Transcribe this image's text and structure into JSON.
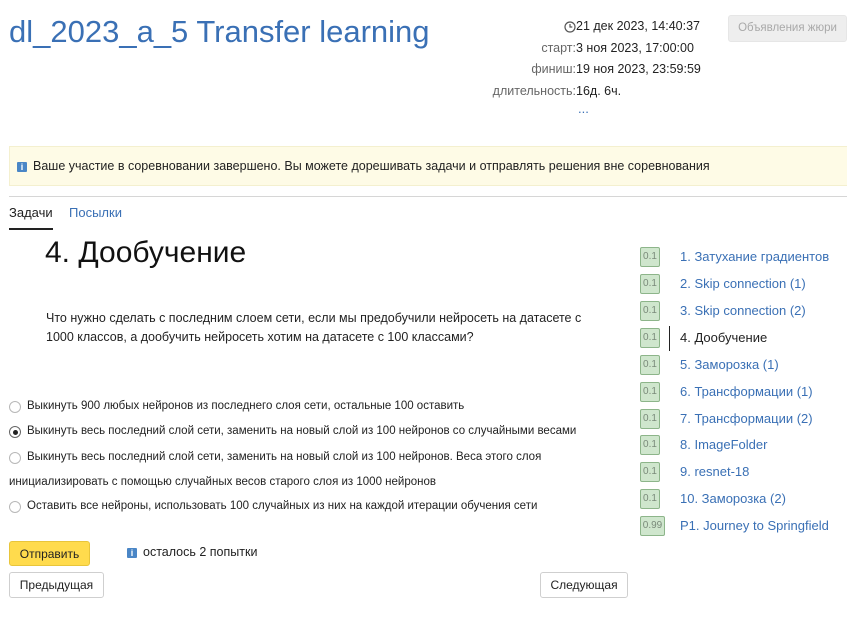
{
  "contest": {
    "title": "dl_2023_a_5 Transfer learning",
    "current_time": "21 дек 2023, 14:40:37",
    "start_label": "старт:",
    "start_value": "3 ноя 2023, 17:00:00",
    "finish_label": "финиш:",
    "finish_value": "19 ноя 2023, 23:59:59",
    "duration_label": "длительность:",
    "duration_value": "16д. 6ч.",
    "more_link": "...",
    "jury_button": "Объявления жюри"
  },
  "notice": {
    "icon": "info-icon",
    "text": "Ваше участие в соревновании завершено. Вы можете дорешивать задачи и отправлять решения вне соревнования"
  },
  "tabs": [
    {
      "label": "Задачи",
      "active": true
    },
    {
      "label": "Посылки",
      "active": false
    }
  ],
  "problem": {
    "title": "4. Дообучение",
    "statement": "Что нужно сделать с последним слоем сети, если мы предобучили нейросеть на датасете с 1000 классов, а дообучить нейросеть хотим на датасете с 100 классами?",
    "options": [
      {
        "text": "Выкинуть 900 любых нейронов из последнего слоя сети, остальные 100 оставить",
        "checked": false
      },
      {
        "text": "Выкинуть весь последний слой сети, заменить на новый слой из 100 нейронов со случайными весами",
        "checked": true
      },
      {
        "text": "Выкинуть весь последний слой сети, заменить на новый слой из 100 нейронов. Веса этого слоя",
        "continuation": "инициализировать с помощью случайных весов старого слоя из 1000 нейронов",
        "checked": false
      },
      {
        "text": "Оставить все нейроны, использовать 100 случайных из них на каждой итерации обучения сети",
        "checked": false
      }
    ],
    "submit_label": "Отправить",
    "attempts_text": "осталось 2 попытки",
    "prev_label": "Предыдущая",
    "next_label": "Следующая"
  },
  "problem_list": [
    {
      "score": "0.1",
      "name": "1. Затухание градиентов",
      "current": false
    },
    {
      "score": "0.1",
      "name": "2. Skip connection (1)",
      "current": false
    },
    {
      "score": "0.1",
      "name": "3. Skip connection (2)",
      "current": false
    },
    {
      "score": "0.1",
      "name": "4. Дообучение",
      "current": true
    },
    {
      "score": "0.1",
      "name": "5. Заморозка (1)",
      "current": false
    },
    {
      "score": "0.1",
      "name": "6. Трансформации (1)",
      "current": false
    },
    {
      "score": "0.1",
      "name": "7. Трансформации (2)",
      "current": false
    },
    {
      "score": "0.1",
      "name": "8. ImageFolder",
      "current": false
    },
    {
      "score": "0.1",
      "name": "9. resnet-18",
      "current": false
    },
    {
      "score": "0.1",
      "name": "10. Заморозка (2)",
      "current": false
    },
    {
      "score": "0.99",
      "name": "P1. Journey to Springfield",
      "current": false
    }
  ],
  "colors": {
    "link": "#3a70b5",
    "submit_button": "#ffdb4d",
    "notice_bg": "#fefbe6",
    "score_badge": "#cfe6cd"
  }
}
